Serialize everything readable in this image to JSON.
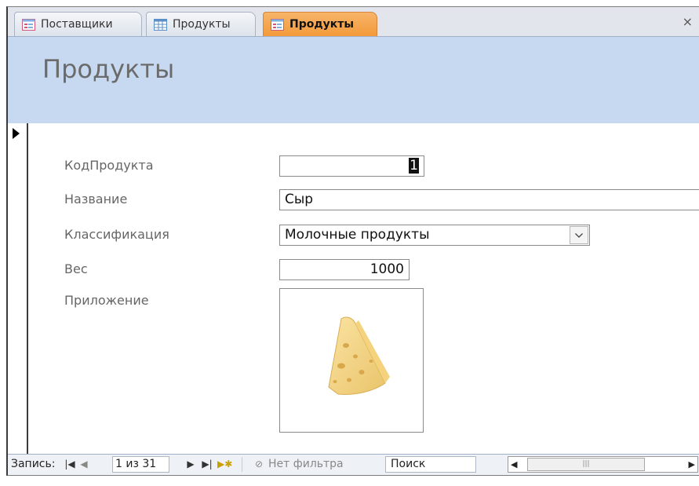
{
  "tabs": [
    {
      "label": "Поставщики",
      "icon": "form-icon",
      "active": false
    },
    {
      "label": "Продукты",
      "icon": "table-icon",
      "active": false
    },
    {
      "label": "Продукты",
      "icon": "form-icon",
      "active": true
    }
  ],
  "close_glyph": "×",
  "form": {
    "title": "Продукты",
    "fields": {
      "id": {
        "label": "КодПродукта",
        "value": "1"
      },
      "name": {
        "label": "Название",
        "value": "Сыр"
      },
      "category": {
        "label": "Классификация",
        "value": "Молочные продукты"
      },
      "weight": {
        "label": "Вес",
        "value": "1000"
      },
      "attachment": {
        "label": "Приложение",
        "image": "cheese-image"
      }
    }
  },
  "navigation": {
    "record_label": "Запись:",
    "record_position": "1 из 31",
    "filter_label": "Нет фильтра",
    "search_placeholder": "Поиск"
  },
  "colors": {
    "header_band": "#c6d9f1",
    "active_tab": "#f39a3a",
    "label_text": "#666666"
  }
}
